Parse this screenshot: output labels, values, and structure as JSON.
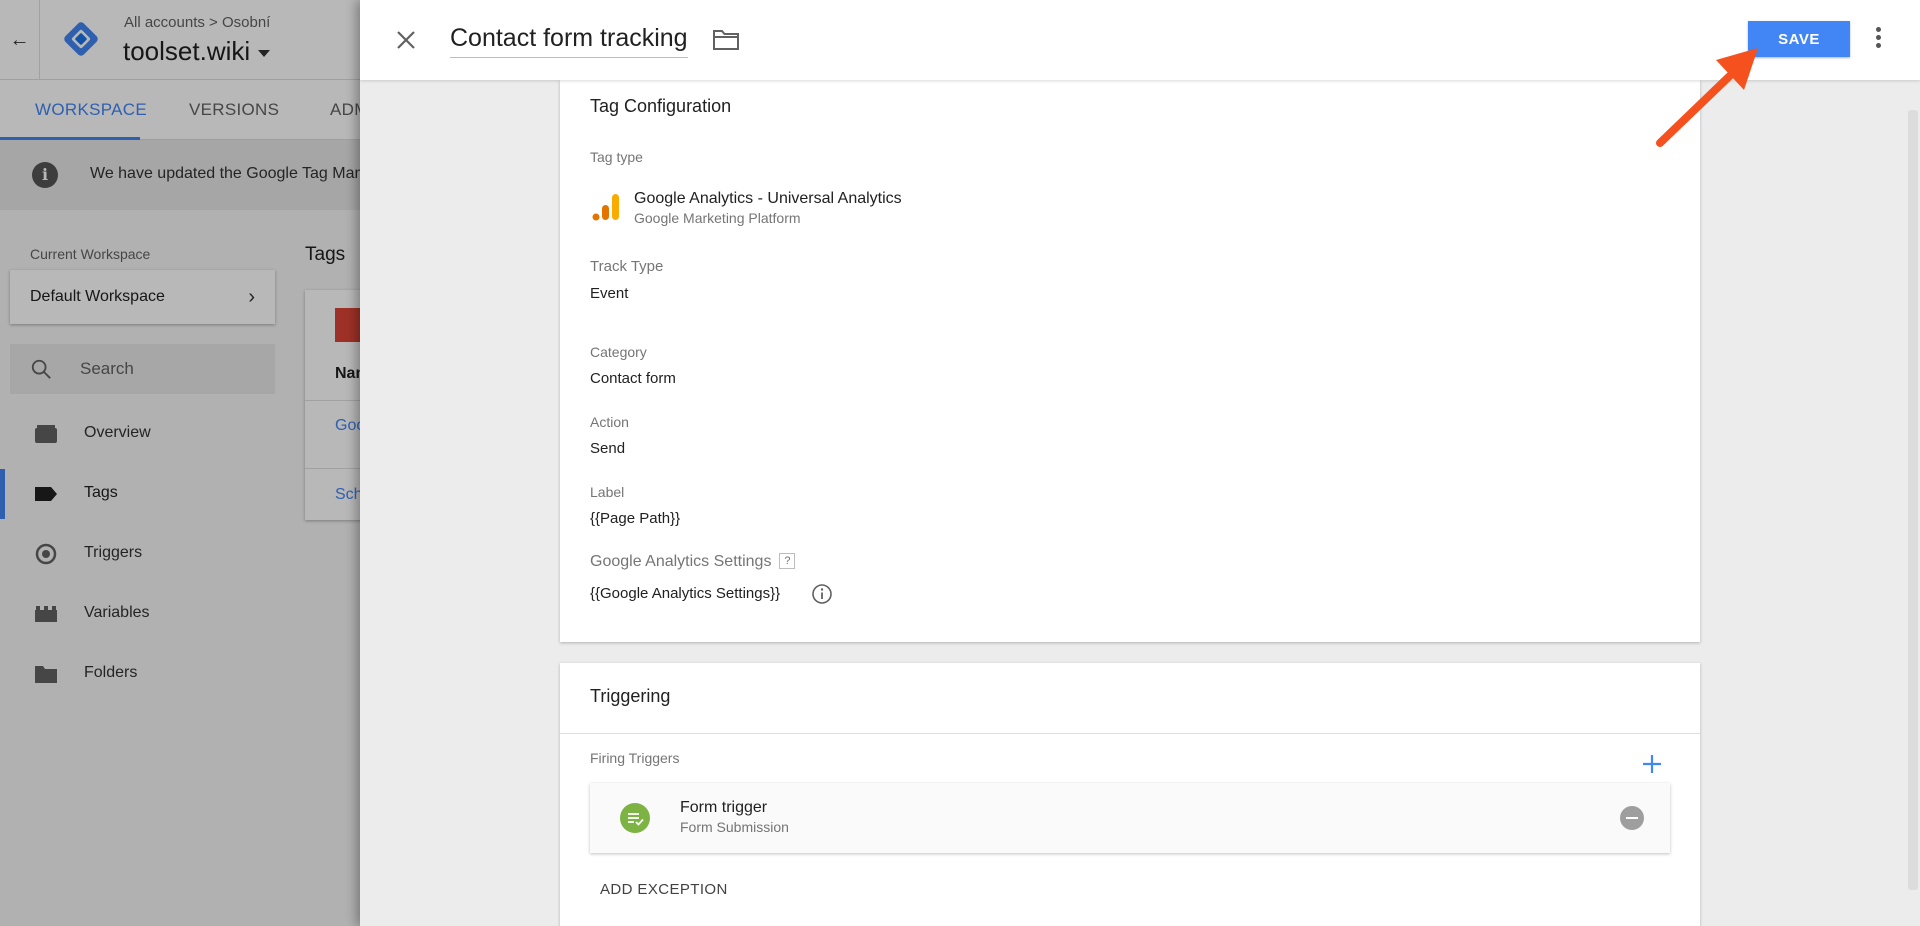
{
  "background_app": {
    "back_icon": "arrow-left-icon",
    "breadcrumb": "All accounts > Osobní",
    "container_name": "toolset.wiki",
    "tabs": [
      {
        "label": "WORKSPACE",
        "active": true
      },
      {
        "label": "VERSIONS",
        "active": false
      },
      {
        "label": "ADMIN",
        "active": false
      }
    ],
    "notice_text": "We have updated the Google Tag Manager",
    "current_workspace_label": "Current Workspace",
    "current_workspace_name": "Default Workspace",
    "search_placeholder": "Search",
    "nav": [
      {
        "label": "Overview",
        "icon": "overview-icon"
      },
      {
        "label": "Tags",
        "icon": "tag-icon",
        "active": true
      },
      {
        "label": "Triggers",
        "icon": "trigger-icon"
      },
      {
        "label": "Variables",
        "icon": "variables-icon"
      },
      {
        "label": "Folders",
        "icon": "folder-icon"
      }
    ],
    "tags_title": "Tags",
    "tags_table": {
      "column_header": "Name",
      "rows": [
        "Google Analytics",
        "Schema"
      ]
    }
  },
  "panel": {
    "title": "Contact form tracking",
    "save_label": "SAVE",
    "tag_configuration": {
      "title": "Tag Configuration",
      "tag_type_label": "Tag type",
      "tag_type_name": "Google Analytics - Universal Analytics",
      "tag_type_vendor": "Google Marketing Platform",
      "track_type_label": "Track Type",
      "track_type_value": "Event",
      "category_label": "Category",
      "category_value": "Contact form",
      "action_label": "Action",
      "action_value": "Send",
      "label_label": "Label",
      "label_value": "{{Page Path}}",
      "ga_settings_label": "Google Analytics Settings",
      "ga_settings_help": "?",
      "ga_settings_value": "{{Google Analytics Settings}}"
    },
    "triggering": {
      "title": "Triggering",
      "firing_triggers_label": "Firing Triggers",
      "triggers": [
        {
          "name": "Form trigger",
          "type": "Form Submission"
        }
      ],
      "add_exception_label": "ADD EXCEPTION"
    }
  },
  "colors": {
    "accent_blue": "#4285f4",
    "trigger_green": "#7cb342",
    "annotation_arrow": "#f4511e",
    "ga_orange": "#f9ab00"
  }
}
